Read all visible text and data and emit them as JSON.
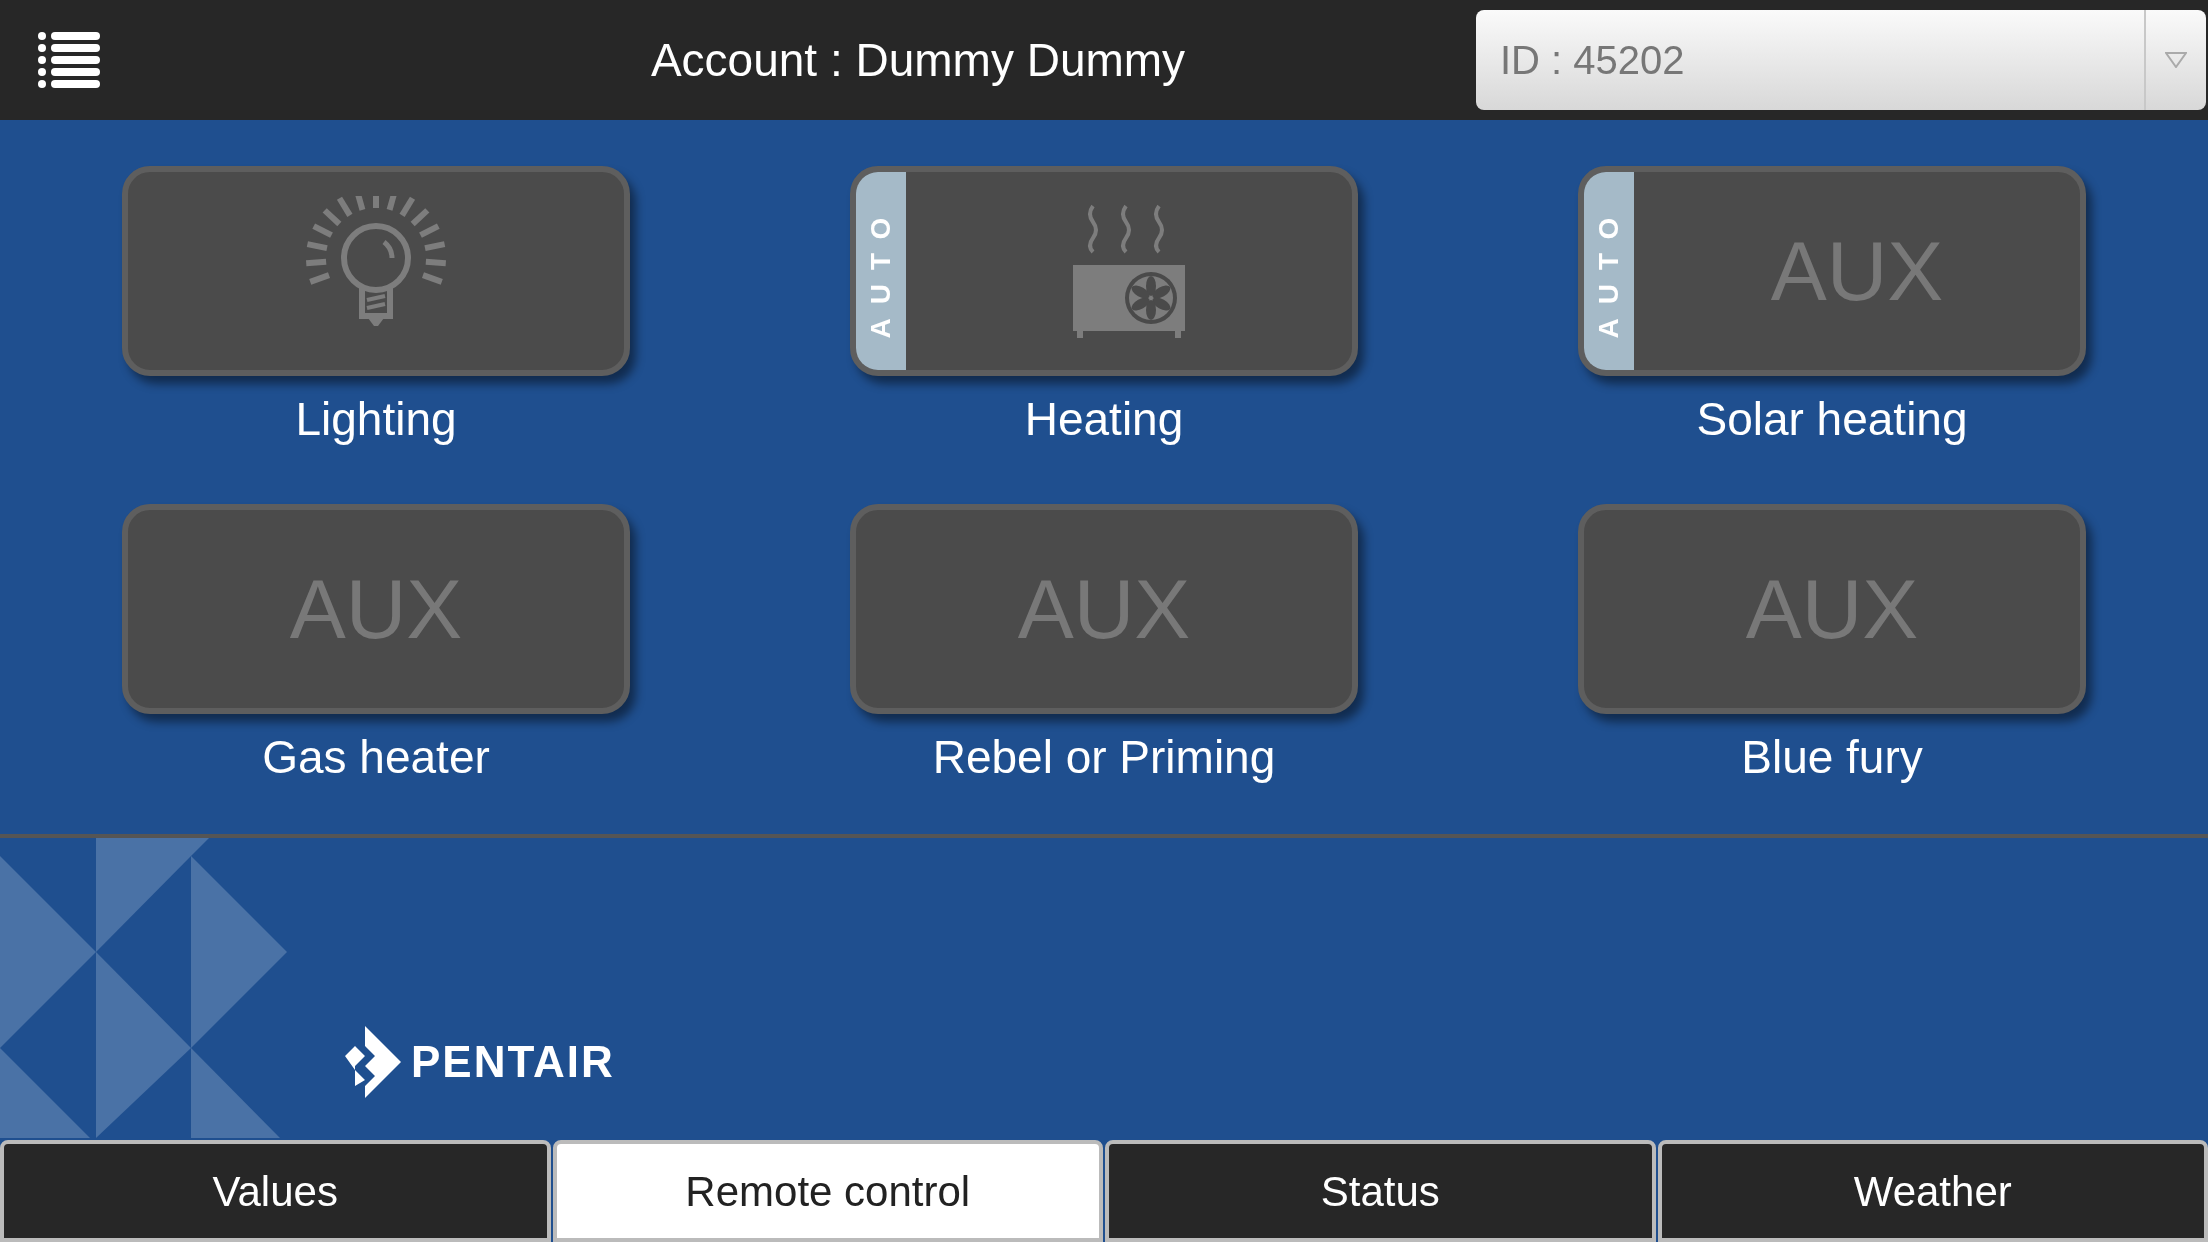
{
  "header": {
    "title": "Account : Dummy Dummy",
    "id_select": {
      "value": "ID : 45202"
    }
  },
  "tiles": [
    {
      "label": "Lighting",
      "kind": "lamp",
      "auto": false
    },
    {
      "label": "Heating",
      "kind": "heater",
      "auto": true,
      "auto_text": "AUTO"
    },
    {
      "label": "Solar heating",
      "kind": "aux",
      "aux_text": "AUX",
      "auto": true,
      "auto_text": "AUTO"
    },
    {
      "label": "Gas heater",
      "kind": "aux",
      "aux_text": "AUX",
      "auto": false
    },
    {
      "label": "Rebel or Priming",
      "kind": "aux",
      "aux_text": "AUX",
      "auto": false
    },
    {
      "label": "Blue fury",
      "kind": "aux",
      "aux_text": "AUX",
      "auto": false
    }
  ],
  "logo": {
    "text": "PENTAIR"
  },
  "tabs": [
    {
      "label": "Values",
      "selected": false
    },
    {
      "label": "Remote control",
      "selected": true
    },
    {
      "label": "Status",
      "selected": false
    },
    {
      "label": "Weather",
      "selected": false
    }
  ]
}
